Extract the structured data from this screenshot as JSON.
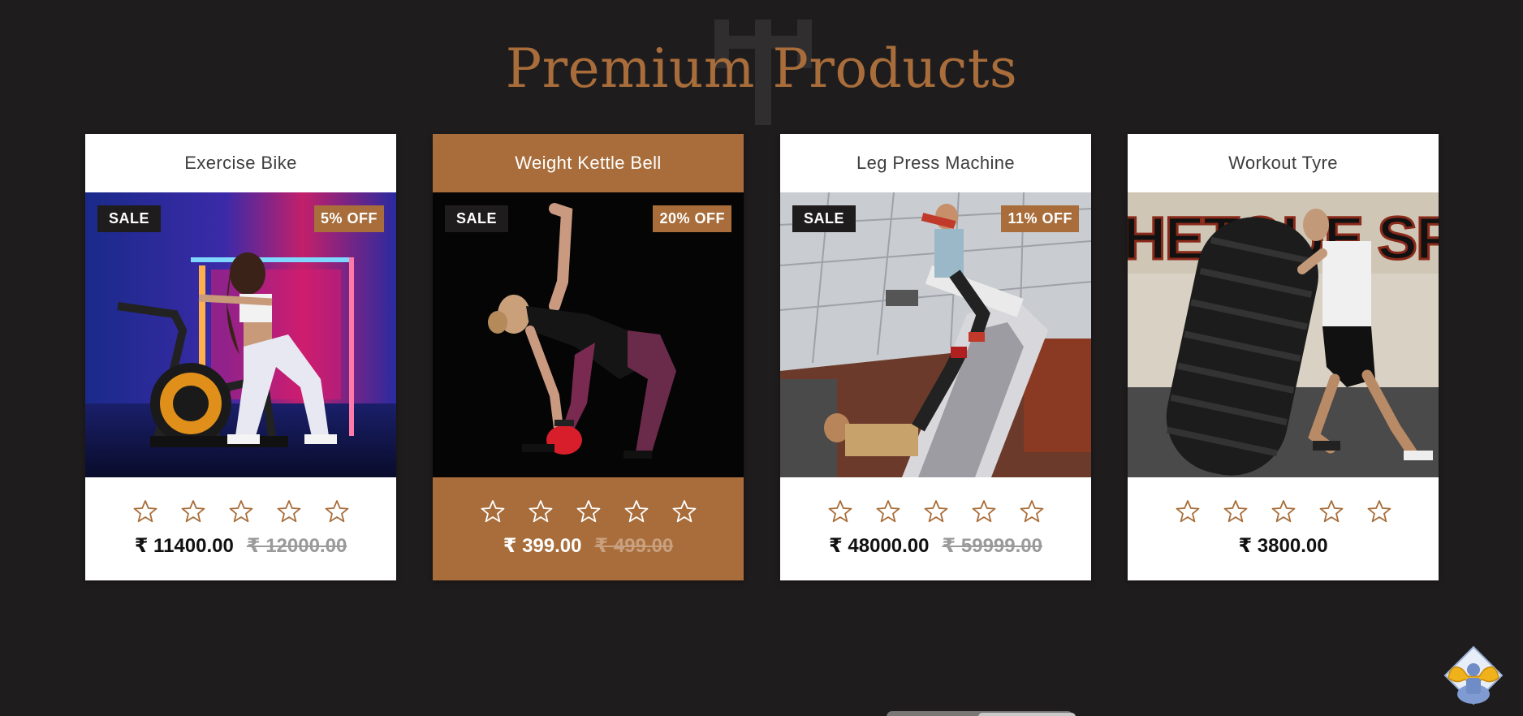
{
  "section": {
    "title": "Premium Products"
  },
  "colors": {
    "background": "#1f1c1d",
    "accent": "#a86d3a",
    "card": "#ffffff"
  },
  "products": [
    {
      "name": "Exercise Bike",
      "sale_badge": "SALE",
      "discount_badge": "5% OFF",
      "rating": 0,
      "price": "₹ 11400.00",
      "old_price": "₹ 12000.00",
      "image": "woman on exercise bike with neon lights"
    },
    {
      "name": "Weight Kettle Bell",
      "sale_badge": "SALE",
      "discount_badge": "20% OFF",
      "rating": 0,
      "price": "₹ 399.00",
      "old_price": "₹ 499.00",
      "image": "woman lifting red kettle bell"
    },
    {
      "name": "Leg Press Machine",
      "sale_badge": "SALE",
      "discount_badge": "11% OFF",
      "rating": 0,
      "price": "₹ 48000.00",
      "old_price": "₹ 59999.00",
      "image": "people using leg press machine"
    },
    {
      "name": "Workout Tyre",
      "rating": 0,
      "price": "₹ 3800.00",
      "image": "man flipping large tyre",
      "wall_text": "HETOUE SPOT"
    }
  ],
  "icons": {
    "star": "star-outline-icon",
    "fab": "bodybuilder-icon"
  }
}
